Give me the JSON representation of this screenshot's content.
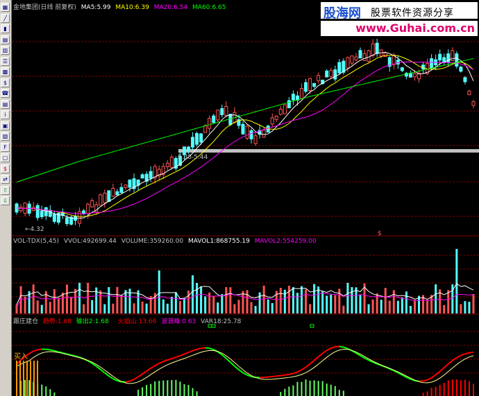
{
  "colors": {
    "up": "#ff5454",
    "down": "#54ffff",
    "ma5": "#ffffff",
    "ma10": "#ffff00",
    "ma20": "#ff00ff",
    "ma60": "#00ff00",
    "grid": "#800000",
    "text": "#c0c0c0"
  },
  "price_panel": {
    "stock": "金地集团(日线 前复权)",
    "ma5": "MA5:5.99",
    "ma10": "MA10:6.39",
    "ma20": "MA20:6.54",
    "ma60": "MA60:6.65",
    "low_label": "←4.32",
    "range_label": "5.38-5.44"
  },
  "volume_panel": {
    "title": "VOL-TDX(5,45)",
    "vvol": "VVOL:492699.44",
    "volume": "VOLUME:359260.00",
    "mavol1": "MAVOL1:868755.19",
    "mavol2": "MAVOL2:554259.00",
    "marker": "$"
  },
  "indicator_panel": {
    "title": "跟庄建仓",
    "trend": "趋势:1.68",
    "out": "输出2:1.68",
    "volcano": "火焰山:13.66",
    "wave": "波浪峰:0.63",
    "var18": "VAR18:25.78",
    "buy_label": "买入"
  },
  "watermark": {
    "brand": "股海网",
    "slogan": "股票软件资源分享",
    "url": "www.Guhai.com.cn"
  },
  "toolbar": {
    "icons": [
      "chart-icon",
      "line-icon",
      "candle-icon",
      "bar-icon",
      "grid-icon",
      "list-icon",
      "calc-icon",
      "money-icon",
      "phone-icon",
      "table-icon",
      "info-icon",
      "multi-icon",
      "doc-icon",
      "f10-icon",
      "window-icon",
      "dollar-icon",
      "swap-icon",
      "up-arrow-icon",
      "down-arrow-icon"
    ]
  }
}
